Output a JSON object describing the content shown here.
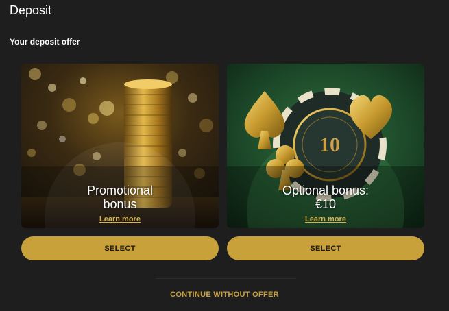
{
  "header": {
    "title": "Deposit"
  },
  "offers_section": {
    "heading": "Your deposit offer"
  },
  "offers": [
    {
      "title_line1": "Promotional",
      "title_line2": "bonus",
      "link_label": "Learn more",
      "button_label": "SELECT",
      "image": "gold-coins-stack-image"
    },
    {
      "title_line1": "Optional bonus:",
      "title_line2": "€10",
      "link_label": "Learn more",
      "button_label": "SELECT",
      "image": "poker-chip-card-suits-image",
      "chip_text": "10"
    }
  ],
  "footer": {
    "continue_label": "CONTINUE WITHOUT OFFER"
  },
  "colors": {
    "background": "#1e1e1e",
    "accent_gold": "#c9a13b",
    "green_card": "#1d4a2a"
  }
}
